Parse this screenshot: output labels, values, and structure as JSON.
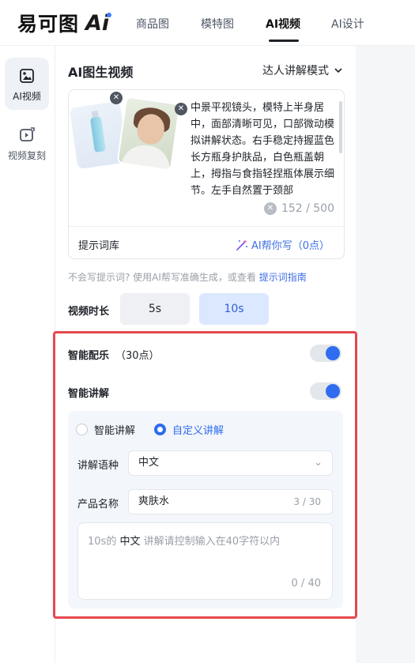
{
  "logo": {
    "text": "易可图",
    "ai": "Ai"
  },
  "nav": [
    {
      "label": "商品图"
    },
    {
      "label": "模特图"
    },
    {
      "label": "AI视频",
      "active": true
    },
    {
      "label": "AI设计"
    }
  ],
  "sidebar": {
    "items": [
      {
        "label": "AI视频",
        "icon": "image-video-icon",
        "active": true
      },
      {
        "label": "视频复刻",
        "icon": "video-copy-icon"
      }
    ]
  },
  "panel": {
    "title": "AI图生视频",
    "mode": "达人讲解模式",
    "prompt_text": "中景平视镜头，模特上半身居中，面部清晰可见，口部微动模拟讲解状态。右手稳定持握蓝色长方瓶身护肤品，白色瓶盖朝上，拇指与食指轻捏瓶体展示细节。左手自然置于颈部",
    "counter": "152 / 500",
    "prompt_library": "提示词库",
    "ai_write": "AI帮你写（0点）",
    "hint_prefix": "不会写提示词? 使用AI帮写准确生成，或查看",
    "hint_link": "提示词指南",
    "duration_label": "视频时长",
    "durations": [
      "5s",
      "10s"
    ],
    "selected_duration": "10s"
  },
  "music": {
    "label": "智能配乐",
    "points": "（30点）",
    "enabled": true
  },
  "narration": {
    "label": "智能讲解",
    "enabled": true,
    "options": [
      "智能讲解",
      "自定义讲解"
    ],
    "selected": "自定义讲解",
    "language_label": "讲解语种",
    "language": "中文",
    "product_label": "产品名称",
    "product_value": "爽肤水",
    "product_count": "3 / 30",
    "ta_prefix": "10s的",
    "ta_lang": "中文",
    "ta_suffix": "讲解请控制输入在40字符以内",
    "ta_count": "0 / 40"
  },
  "colors": {
    "accent": "#2e6cf0",
    "highlight_border": "#e5484d"
  }
}
